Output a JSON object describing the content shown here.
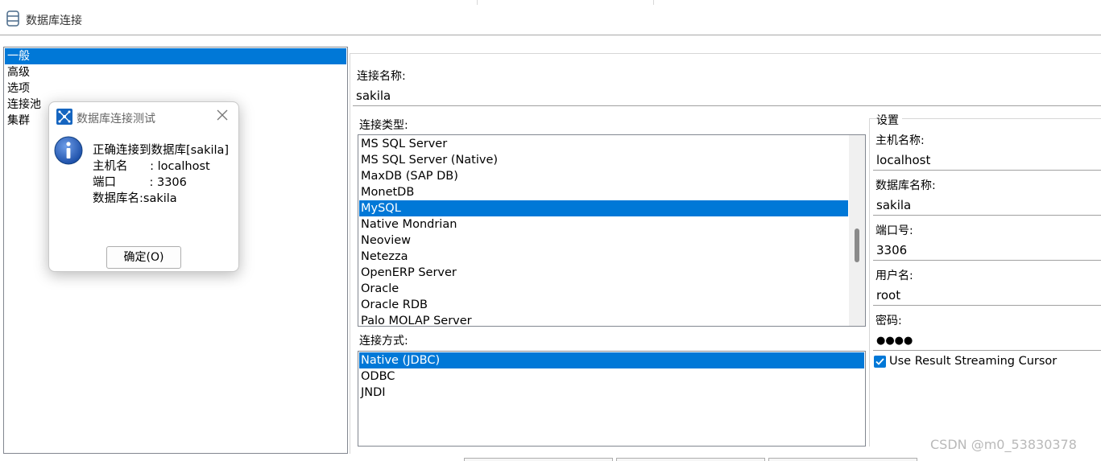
{
  "window": {
    "title": "数据库连接"
  },
  "categories": [
    {
      "label": "一般",
      "selected": true
    },
    {
      "label": "高级",
      "selected": false
    },
    {
      "label": "选项",
      "selected": false
    },
    {
      "label": "连接池",
      "selected": false
    },
    {
      "label": "集群",
      "selected": false
    }
  ],
  "form": {
    "connection_name_label": "连接名称:",
    "connection_name_value": "sakila",
    "connection_type_label": "连接类型:",
    "connection_types": [
      {
        "label": "MS SQL Server",
        "selected": false
      },
      {
        "label": "MS SQL Server (Native)",
        "selected": false
      },
      {
        "label": "MaxDB (SAP DB)",
        "selected": false
      },
      {
        "label": "MonetDB",
        "selected": false
      },
      {
        "label": "MySQL",
        "selected": true
      },
      {
        "label": "Native Mondrian",
        "selected": false
      },
      {
        "label": "Neoview",
        "selected": false
      },
      {
        "label": "Netezza",
        "selected": false
      },
      {
        "label": "OpenERP Server",
        "selected": false
      },
      {
        "label": "Oracle",
        "selected": false
      },
      {
        "label": "Oracle RDB",
        "selected": false
      },
      {
        "label": "Palo MOLAP Server",
        "selected": false
      }
    ],
    "access_label": "连接方式:",
    "access_methods": [
      {
        "label": "Native (JDBC)",
        "selected": true
      },
      {
        "label": "ODBC",
        "selected": false
      },
      {
        "label": "JNDI",
        "selected": false
      }
    ]
  },
  "settings": {
    "group_label": "设置",
    "host_label": "主机名称:",
    "host_value": "localhost",
    "database_label": "数据库名称:",
    "database_value": "sakila",
    "port_label": "端口号:",
    "port_value": "3306",
    "user_label": "用户名:",
    "user_value": "root",
    "password_label": "密码:",
    "password_value": "●●●●",
    "streaming_label": "Use Result Streaming Cursor",
    "streaming_checked": true
  },
  "dialog": {
    "title": "数据库连接测试",
    "message_line1": "正确连接到数据库[sakila]",
    "message_line2": "主机名      : localhost",
    "message_line3": "端口         : 3306",
    "message_line4": "数据库名:sakila",
    "ok_label": "确定(O)"
  },
  "watermark": "CSDN @m0_53830378",
  "colors": {
    "selection": "#0078d7",
    "dialog_icon": "#1565c0"
  }
}
